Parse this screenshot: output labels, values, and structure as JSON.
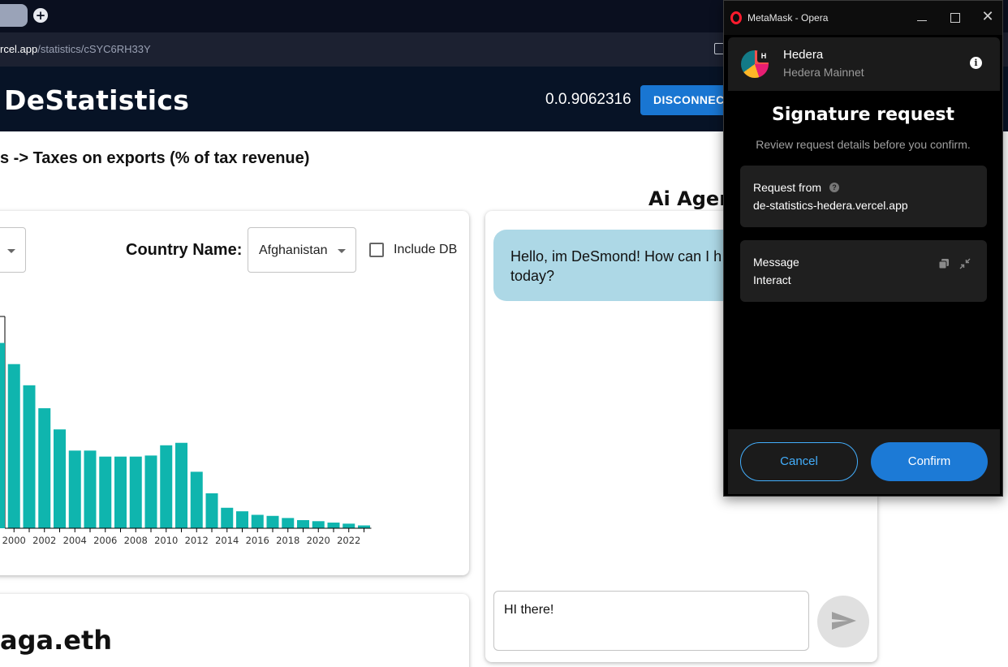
{
  "browser": {
    "url_host_tail": "rcel.app",
    "url_path": "/statistics/cSYC6RH33Y",
    "new_tab_glyph": "+"
  },
  "header": {
    "logo": "DeStatistics",
    "account_id": "0.0.9062316",
    "disconnect_label": "DISCONNECT"
  },
  "page": {
    "breadcrumb": "s -> Taxes on exports (% of tax revenue)"
  },
  "filters": {
    "country_label": "Country Name:",
    "country_value": "Afghanistan",
    "include_db_label": "Include DB",
    "include_db_checked": false
  },
  "chart_data": {
    "type": "bar",
    "title": "",
    "xlabel": "",
    "ylabel": "",
    "color": "#0fb5ae",
    "x": [
      1999,
      2000,
      2001,
      2002,
      2003,
      2004,
      2005,
      2006,
      2007,
      2008,
      2009,
      2010,
      2011,
      2012,
      2013,
      2014,
      2015,
      2016,
      2017,
      2018,
      2019,
      2020,
      2021,
      2022,
      2023
    ],
    "values": [
      52.5,
      46.5,
      40.5,
      34.0,
      28.0,
      22.0,
      22.0,
      20.3,
      20.3,
      20.3,
      20.6,
      23.5,
      24.2,
      16.0,
      9.9,
      5.8,
      4.8,
      3.8,
      3.5,
      2.9,
      2.3,
      2.0,
      1.6,
      1.3,
      0.8
    ],
    "tick_labels": [
      "2000",
      "2002",
      "2004",
      "2006",
      "2008",
      "2010",
      "2012",
      "2014",
      "2016",
      "2018",
      "2020",
      "2022"
    ],
    "ylim": [
      0,
      60
    ]
  },
  "ens": {
    "name": "aga.eth"
  },
  "ai": {
    "title": "Ai Agent",
    "greeting": "Hello, im DeSmond! How can I h\ntoday?",
    "input_value": "HI there!"
  },
  "metamask": {
    "window_title": "MetaMask - Opera",
    "close_glyph": "✕",
    "network_name": "Hedera",
    "network_sub": "Hedera Mainnet",
    "network_badge": "H",
    "heading": "Signature request",
    "subheading": "Review request details before you confirm.",
    "request_from_label": "Request from",
    "request_from_value": "de-statistics-hedera.vercel.app",
    "message_label": "Message",
    "message_value": "Interact",
    "cancel_label": "Cancel",
    "confirm_label": "Confirm",
    "accent": "#43aefc"
  }
}
